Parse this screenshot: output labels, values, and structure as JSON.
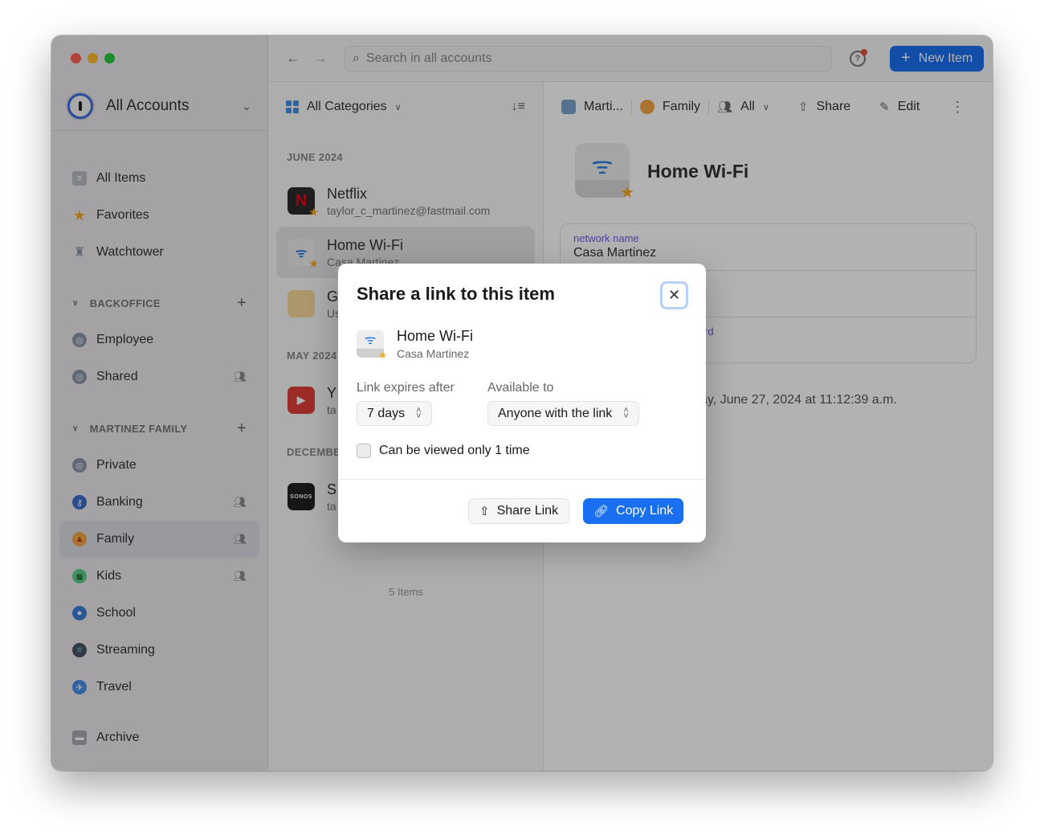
{
  "window": {
    "traffic_lights": {
      "close": "#ff5f57",
      "minimize": "#febc2e",
      "zoom": "#28c840"
    }
  },
  "sidebar": {
    "account": {
      "label": "All Accounts",
      "icon": "1password-logo-icon"
    },
    "top_items": [
      {
        "label": "All Items",
        "icon": "all-items-icon"
      },
      {
        "label": "Favorites",
        "icon": "star-icon"
      },
      {
        "label": "Watchtower",
        "icon": "watchtower-icon"
      }
    ],
    "sections": [
      {
        "title": "BACKOFFICE",
        "items": [
          {
            "label": "Employee",
            "icon": "vault-icon",
            "shared": false
          },
          {
            "label": "Shared",
            "icon": "vault-icon",
            "shared": true
          }
        ]
      },
      {
        "title": "MARTINEZ FAMILY",
        "items": [
          {
            "label": "Private",
            "icon": "vault-icon",
            "shared": false
          },
          {
            "label": "Banking",
            "icon": "key-icon",
            "shared": true
          },
          {
            "label": "Family",
            "icon": "tent-icon",
            "shared": true,
            "active": true
          },
          {
            "label": "Kids",
            "icon": "backpack-icon",
            "shared": true
          },
          {
            "label": "School",
            "icon": "school-icon",
            "shared": false
          },
          {
            "label": "Streaming",
            "icon": "streaming-icon",
            "shared": false
          },
          {
            "label": "Travel",
            "icon": "airplane-icon",
            "shared": false
          }
        ]
      }
    ],
    "bottom_items": [
      {
        "label": "Archive",
        "icon": "archive-icon"
      }
    ]
  },
  "toolbar": {
    "back": "←",
    "forward": "→",
    "search_placeholder": "Search in all accounts",
    "new_item_label": "New Item"
  },
  "list": {
    "category_label": "All Categories",
    "groups": [
      {
        "title": "JUNE 2024",
        "items": [
          {
            "title": "Netflix",
            "subtitle": "taylor_c_martinez@fastmail.com",
            "favorite": true
          },
          {
            "title": "Home Wi-Fi",
            "subtitle": "Casa Martinez",
            "favorite": true,
            "active": true
          },
          {
            "title": "G",
            "subtitle": "Us"
          }
        ]
      },
      {
        "title": "MAY 2024",
        "items": [
          {
            "title": "Y",
            "subtitle": "ta"
          }
        ]
      },
      {
        "title": "DECEMBE",
        "items": [
          {
            "title": "S",
            "subtitle": "ta"
          }
        ]
      }
    ],
    "count": "5 Items"
  },
  "detail": {
    "toolbar": {
      "account": "Marti...",
      "vault": "Family",
      "people": "All",
      "share": "Share",
      "edit": "Edit"
    },
    "title": "Home Wi-Fi",
    "fields": [
      {
        "label": "network name",
        "value": "Casa Martinez"
      },
      {
        "label": "",
        "value": ""
      },
      {
        "label": "rd",
        "value": ""
      }
    ],
    "modified": "ay, June 27, 2024 at 11:12:39 a.m."
  },
  "modal": {
    "title": "Share a link to this item",
    "close": "✕",
    "item": {
      "title": "Home Wi-Fi",
      "subtitle": "Casa Martinez"
    },
    "expires_label": "Link expires after",
    "expires_value": "7 days",
    "available_label": "Available to",
    "available_value": "Anyone with the link",
    "checkbox_label": "Can be viewed only 1 time",
    "checkbox_checked": false,
    "share_button": "Share Link",
    "copy_button": "Copy Link",
    "accent": "#1a6ff0"
  }
}
